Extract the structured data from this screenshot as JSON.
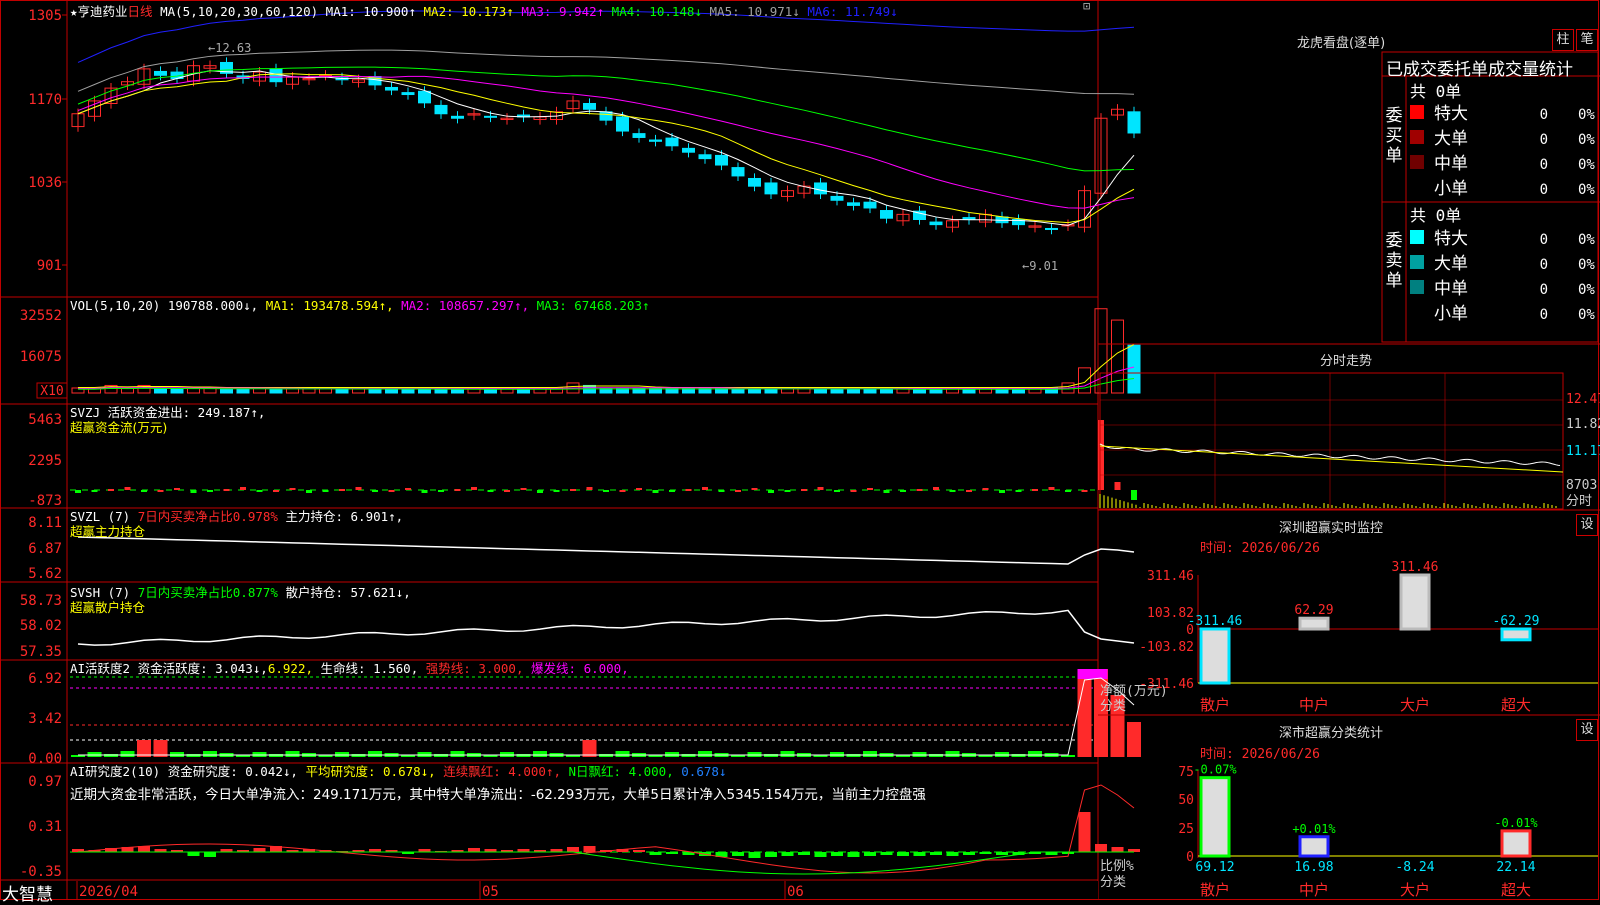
{
  "colors": {
    "up": "#ff2a2a",
    "down": "#00e5ff",
    "axis": "#c00000",
    "ma1": "#ffffff",
    "ma2": "#ffff00",
    "ma3": "#ff00ff",
    "ma4": "#00ff00",
    "ma5": "#a0a0a0",
    "ma6": "#2020ff",
    "green": "#00ff00"
  },
  "main": {
    "star": "★",
    "stock_name": "亨迪药业",
    "period": "日线",
    "ma_label": "MA(5,10,20,30,60,120)",
    "ma_items": [
      {
        "label": "MA1:",
        "value": "10.900",
        "arrow": "↑",
        "color": "#ffffff"
      },
      {
        "label": "MA2:",
        "value": "10.173",
        "arrow": "↑",
        "color": "#ffff00"
      },
      {
        "label": "MA3:",
        "value": "9.942",
        "arrow": "↑",
        "color": "#ff00ff"
      },
      {
        "label": "MA4:",
        "value": "10.148",
        "arrow": "↓",
        "color": "#00ff00"
      },
      {
        "label": "MA5:",
        "value": "10.971",
        "arrow": "↓",
        "color": "#a0a0a0"
      },
      {
        "label": "MA6:",
        "value": "11.749",
        "arrow": "↓",
        "color": "#2020ff"
      }
    ],
    "yticks": [
      "1305",
      "1170",
      "1036",
      "901"
    ],
    "high_note": "12.63",
    "low_note": "9.01"
  },
  "vol": {
    "header": "VOL(5,10,20) 190788.000↓,",
    "ma1": "MA1: 193478.594↑,",
    "ma2": "MA2: 108657.297↑,",
    "ma3": "MA3: 67468.203↑",
    "yticks": [
      "32552",
      "16075"
    ],
    "unit": "X10"
  },
  "svzj": {
    "header": "SVZJ  活跃资金进出: 249.187↑,",
    "sub": "超赢资金流(万元)",
    "yticks": [
      "5463",
      "2295",
      "-873"
    ]
  },
  "svzl": {
    "header_a": "SVZL (7)",
    "header_b": "7日内买卖净占比0.978%",
    "header_c": "主力持仓: 6.901↑,",
    "sub": "超赢主力持仓",
    "yticks": [
      "8.11",
      "6.87",
      "5.62"
    ]
  },
  "svsh": {
    "header_a": "SVSH (7)",
    "header_b": "7日内买卖净占比0.877%",
    "header_c": "散户持仓: 57.621↓,",
    "sub": "超赢散户持仓",
    "yticks": [
      "58.73",
      "58.02",
      "57.35"
    ]
  },
  "ai1": {
    "header_a": "AI活跃度2 资金活跃度: 3.043↓,",
    "header_b": "6.922,",
    "header_c": "生命线: 1.560,",
    "header_d": "强势线: 3.000,",
    "header_e": "爆发线: 6.000,",
    "yticks": [
      "6.92",
      "3.42",
      "0.00"
    ]
  },
  "ai2": {
    "header_a": "AI研究度2(10) 资金研究度: 0.042↓,",
    "header_b": "平均研究度: 0.678↓,",
    "header_c": "连续飘红: 4.000↑,",
    "header_d": "N日飘红: 4.000,",
    "header_e": "0.678↓",
    "desc": "近期大资金非常活跃，今日大单净流入：249.171万元，其中特大单净流出：-62.293万元，大单5日累计净入5345.154万元，当前主力控盘强",
    "yticks": [
      "0.97",
      "0.31",
      "-0.35"
    ]
  },
  "bottom": {
    "brand": "大智慧",
    "dates": [
      "2026/04",
      "05",
      "06"
    ]
  },
  "right": {
    "lhb_title": "龙虎看盘(逐单)",
    "btn_zhu": "柱",
    "btn_bi": "笔",
    "tabs": "已成交委托单成交量统计",
    "buy_label": "委买单",
    "sell_label": "委卖单",
    "buy_total": "共 0单",
    "sell_total": "共 0单",
    "buy_rows": [
      {
        "name": "特大",
        "count": "0",
        "pct": "0%",
        "color": "#ff0000"
      },
      {
        "name": "大单",
        "count": "0",
        "pct": "0%",
        "color": "#a00000"
      },
      {
        "name": "中单",
        "count": "0",
        "pct": "0%",
        "color": "#700000"
      },
      {
        "name": "小单",
        "count": "0",
        "pct": "0%",
        "color": ""
      }
    ],
    "sell_rows": [
      {
        "name": "特大",
        "count": "0",
        "pct": "0%",
        "color": "#00ffff"
      },
      {
        "name": "大单",
        "count": "0",
        "pct": "0%",
        "color": "#00a0a0"
      },
      {
        "name": "中单",
        "count": "0",
        "pct": "0%",
        "color": "#008080"
      },
      {
        "name": "小单",
        "count": "0",
        "pct": "0%",
        "color": ""
      }
    ],
    "fs_title": "分时走势",
    "fs_yticks": [
      "12.47",
      "11.82",
      "11.17"
    ],
    "fs_vol": "8703",
    "fs_unit": "分时",
    "mon_title": "深圳超赢实时监控",
    "mon_btn": "设",
    "mon_time": "时间: 2026/06/26",
    "mon_yticks": [
      "311.46",
      "103.82",
      "0",
      "-103.82",
      "-311.46"
    ],
    "mon_axis_label": "净额(万元)",
    "mon_axis_label2": "分类",
    "mon_bars": [
      {
        "cat": "散户",
        "value": -311.46,
        "label": "-311.46"
      },
      {
        "cat": "中户",
        "value": 62.29,
        "label": "62.29"
      },
      {
        "cat": "大户",
        "value": 311.46,
        "label": "311.46"
      },
      {
        "cat": "超大",
        "value": -62.29,
        "label": "-62.29"
      }
    ],
    "cls_title": "深市超赢分类统计",
    "cls_btn": "设",
    "cls_time": "时间: 2026/06/26",
    "cls_yticks": [
      "75",
      "50",
      "25",
      "0"
    ],
    "cls_axis_label": "比例%",
    "cls_axis_label2": "分类",
    "cls_bars": [
      {
        "cat": "散户",
        "value": 69.12,
        "top": "-0.07%",
        "bottom": "69.12",
        "color": "#00ff00"
      },
      {
        "cat": "中户",
        "value": 16.98,
        "top": "+0.01%",
        "bottom": "16.98",
        "color": "#2020ff"
      },
      {
        "cat": "大户",
        "value": -8.24,
        "top": "",
        "bottom": "-8.24",
        "color": "#00ffff"
      },
      {
        "cat": "超大",
        "value": 22.14,
        "top": "-0.01%",
        "bottom": "22.14",
        "color": "#ff2a2a"
      }
    ]
  },
  "chart_data": {
    "type": "candlestick",
    "title": "亨迪药业 日线",
    "close": [
      11.55,
      11.75,
      11.95,
      12.05,
      12.25,
      12.15,
      12.1,
      12.3,
      12.3,
      12.18,
      12.1,
      12.2,
      12.05,
      12.12,
      12.1,
      12.15,
      12.08,
      12.08,
      12.0,
      11.92,
      11.85,
      11.72,
      11.55,
      11.48,
      11.55,
      11.5,
      11.48,
      11.5,
      11.5,
      11.58,
      11.75,
      11.62,
      11.45,
      11.28,
      11.18,
      11.12,
      11.05,
      10.95,
      10.85,
      10.75,
      10.58,
      10.42,
      10.3,
      10.35,
      10.42,
      10.3,
      10.2,
      10.12,
      10.08,
      9.92,
      9.98,
      9.9,
      9.82,
      9.88,
      9.9,
      9.98,
      9.85,
      9.82,
      9.8,
      9.75,
      9.82,
      10.35,
      11.48,
      11.62,
      11.25
    ],
    "volume": [
      1,
      1,
      2,
      1,
      2,
      1,
      1,
      1,
      1,
      1,
      1,
      1,
      1,
      1,
      1,
      1,
      1,
      1,
      1,
      1,
      1,
      1,
      1,
      1,
      1,
      1,
      1,
      1,
      1,
      1,
      3,
      2,
      1,
      1,
      1,
      1,
      1,
      1,
      1,
      1,
      1,
      1,
      1,
      1,
      1,
      1,
      1,
      1,
      1,
      1,
      1,
      1,
      1,
      1,
      1,
      1,
      1,
      1,
      1,
      1,
      3,
      9,
      32.5,
      28,
      18
    ]
  }
}
